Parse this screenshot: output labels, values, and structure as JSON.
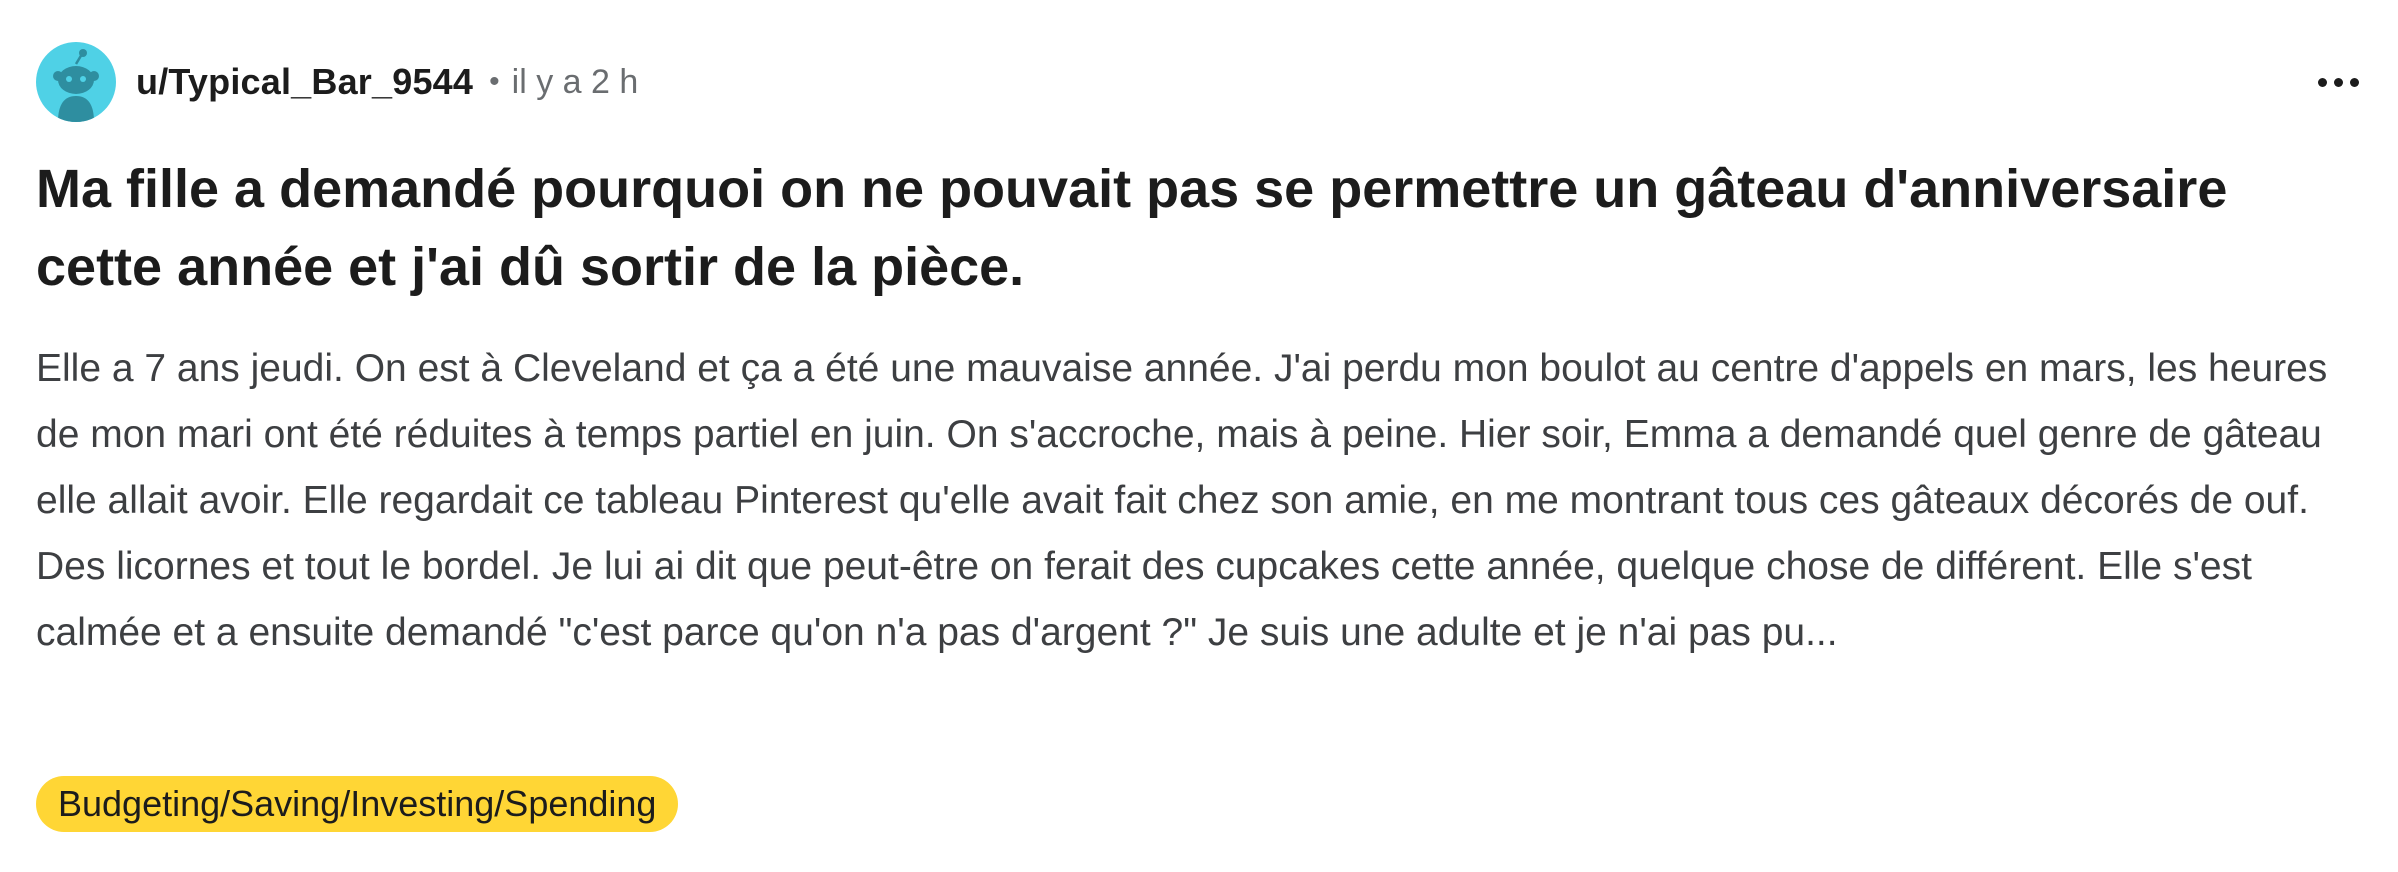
{
  "post": {
    "author": "u/Typical_Bar_9544",
    "separator": "•",
    "time": "il y a 2 h",
    "title": "Ma fille a demandé pourquoi on ne pouvait pas se permettre un gâteau d'anniversaire cette année et j'ai dû sortir de la pièce.",
    "body": "Elle a 7 ans jeudi. On est à Cleveland et ça a été une mauvaise année. J'ai perdu mon boulot au centre d'appels en mars, les heures de mon mari ont été réduites à temps partiel en juin. On s'accroche, mais à peine. Hier soir, Emma a demandé quel genre de gâteau elle allait avoir. Elle regardait ce tableau Pinterest qu'elle avait fait chez son amie, en me montrant tous ces gâteaux décorés de ouf. Des licornes et tout le bordel. Je lui ai dit que peut-être on ferait des cupcakes cette année, quelque chose de différent. Elle s'est calmée et a ensuite demandé \"c'est parce qu'on n'a pas d'argent ?\" Je suis une adulte et je n'ai pas pu...",
    "flair": "Budgeting/Saving/Investing/Spending"
  },
  "icons": {
    "avatar": "snoo-avatar-icon",
    "more": "more-options-icon"
  },
  "colors": {
    "avatar_bg": "#4fd1e6",
    "flair_bg": "#ffd635",
    "text_primary": "#1c1c1c",
    "text_secondary": "#6a6d70"
  }
}
